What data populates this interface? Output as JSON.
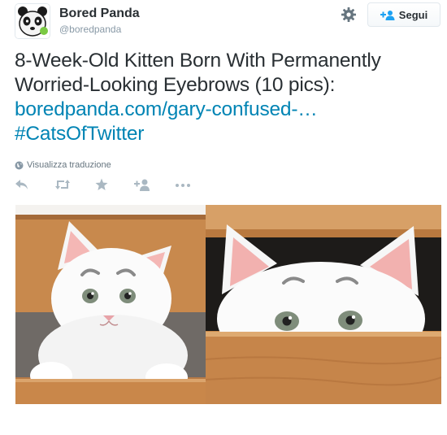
{
  "author": {
    "name": "Bored Panda",
    "handle": "@boredpanda"
  },
  "follow_button": {
    "label": "Segui"
  },
  "tweet": {
    "line1": "8-Week-Old Kitten Born With Permanently",
    "line2": "Worried-Looking Eyebrows (10 pics):",
    "link": "boredpanda.com/gary-confused-…",
    "hashtag": "#CatsOfTwitter"
  },
  "translate_label": "Visualizza traduzione",
  "actions": [
    "reply-icon",
    "retweet-icon",
    "favorite-icon",
    "follow-icon",
    "more-icon"
  ],
  "colors": {
    "link": "#0084b4",
    "name": "#292f33",
    "meta": "#8899a6",
    "follow_accent": "#1da1f2",
    "wood": "#c98a4b"
  }
}
